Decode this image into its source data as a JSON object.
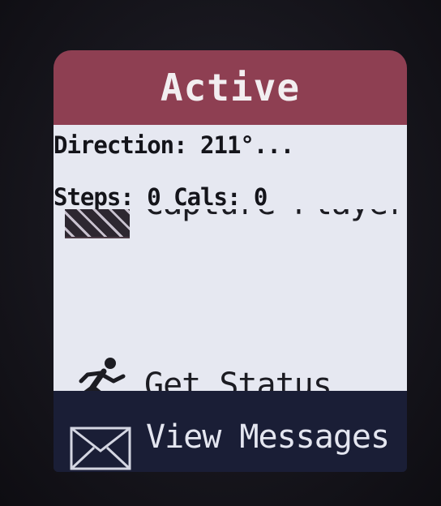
{
  "header": {
    "title": "Active"
  },
  "info": {
    "direction": "Direction: 211°...",
    "steps": "Steps: 0 Cals: 0"
  },
  "menu": {
    "capture_label": "Capture Player",
    "status_label": "Get Status",
    "messages_label": "View Messages"
  },
  "icons": {
    "capture": "capture-icon",
    "status": "running-figure-icon",
    "messages": "envelope-icon"
  },
  "colors": {
    "header": "#8e3f52",
    "content": "#e6e8f1",
    "bottom": "#1a1e36"
  }
}
